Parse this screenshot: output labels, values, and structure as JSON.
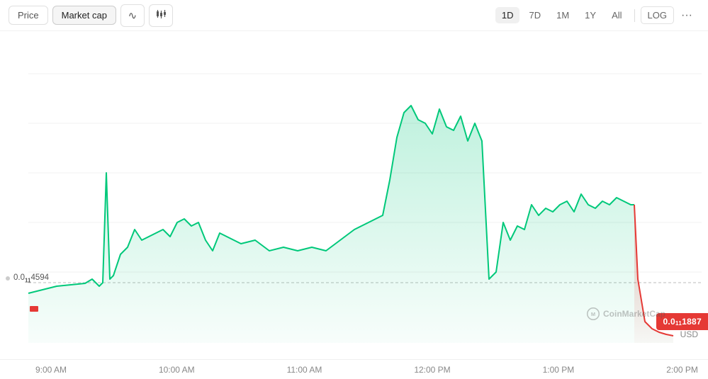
{
  "toolbar": {
    "tabs": [
      {
        "id": "price",
        "label": "Price",
        "active": false
      },
      {
        "id": "marketcap",
        "label": "Market cap",
        "active": true
      }
    ],
    "icons": [
      {
        "name": "line-chart-icon",
        "symbol": "∿"
      },
      {
        "name": "candle-chart-icon",
        "symbol": "⛾"
      }
    ],
    "periods": [
      {
        "id": "1d",
        "label": "1D",
        "active": true
      },
      {
        "id": "7d",
        "label": "7D",
        "active": false
      },
      {
        "id": "1m",
        "label": "1M",
        "active": false
      },
      {
        "id": "1y",
        "label": "1Y",
        "active": false
      },
      {
        "id": "all",
        "label": "All",
        "active": false
      }
    ],
    "log_label": "LOG",
    "more_label": "···"
  },
  "chart": {
    "price_level_label": "0.0₁₁4594",
    "current_price_label": "0.0",
    "current_price_sub": "11",
    "current_price_decimals": "1887",
    "currency": "USD",
    "watermark": "CoinMarketCap"
  },
  "xaxis": {
    "labels": [
      "9:00 AM",
      "10:00 AM",
      "11:00 AM",
      "12:00 PM",
      "1:00 PM",
      "2:00 PM"
    ]
  }
}
